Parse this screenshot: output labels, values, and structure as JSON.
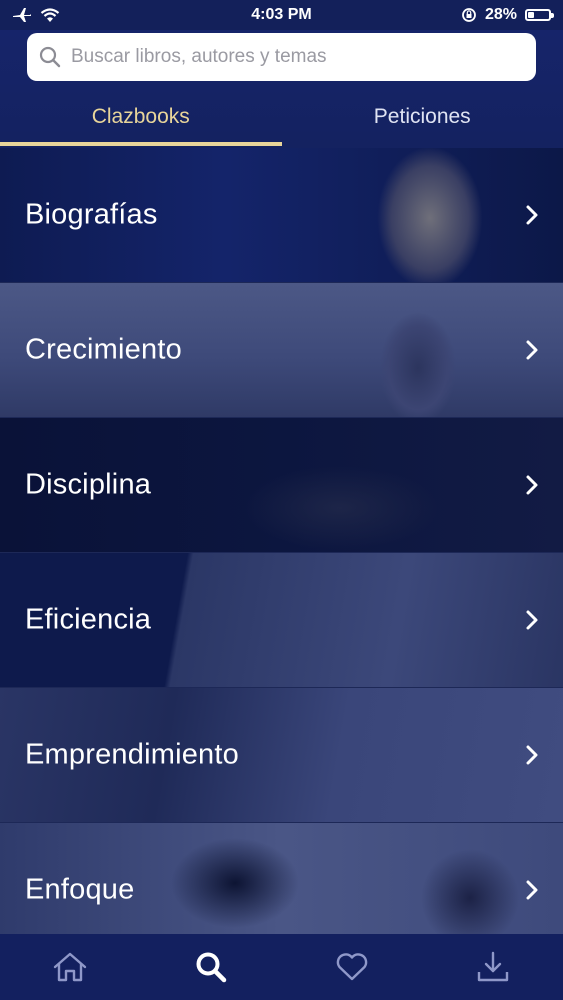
{
  "status": {
    "time": "4:03 PM",
    "battery": "28%",
    "battery_level": 0.28
  },
  "search": {
    "placeholder": "Buscar libros, autores y temas"
  },
  "tabs": [
    {
      "label": "Clazbooks",
      "active": true
    },
    {
      "label": "Peticiones",
      "active": false
    }
  ],
  "categories": [
    {
      "label": "Biografías"
    },
    {
      "label": "Crecimiento"
    },
    {
      "label": "Disciplina"
    },
    {
      "label": "Eficiencia"
    },
    {
      "label": "Emprendimiento"
    },
    {
      "label": "Enfoque"
    }
  ],
  "bottom_nav": [
    {
      "icon": "home-icon",
      "active": false
    },
    {
      "icon": "search-icon",
      "active": true
    },
    {
      "icon": "heart-icon",
      "active": false
    },
    {
      "icon": "download-icon",
      "active": false
    }
  ],
  "colors": {
    "background": "#0f1b4d",
    "accent": "#e8d59a",
    "nav_inactive": "#8f98c9"
  }
}
